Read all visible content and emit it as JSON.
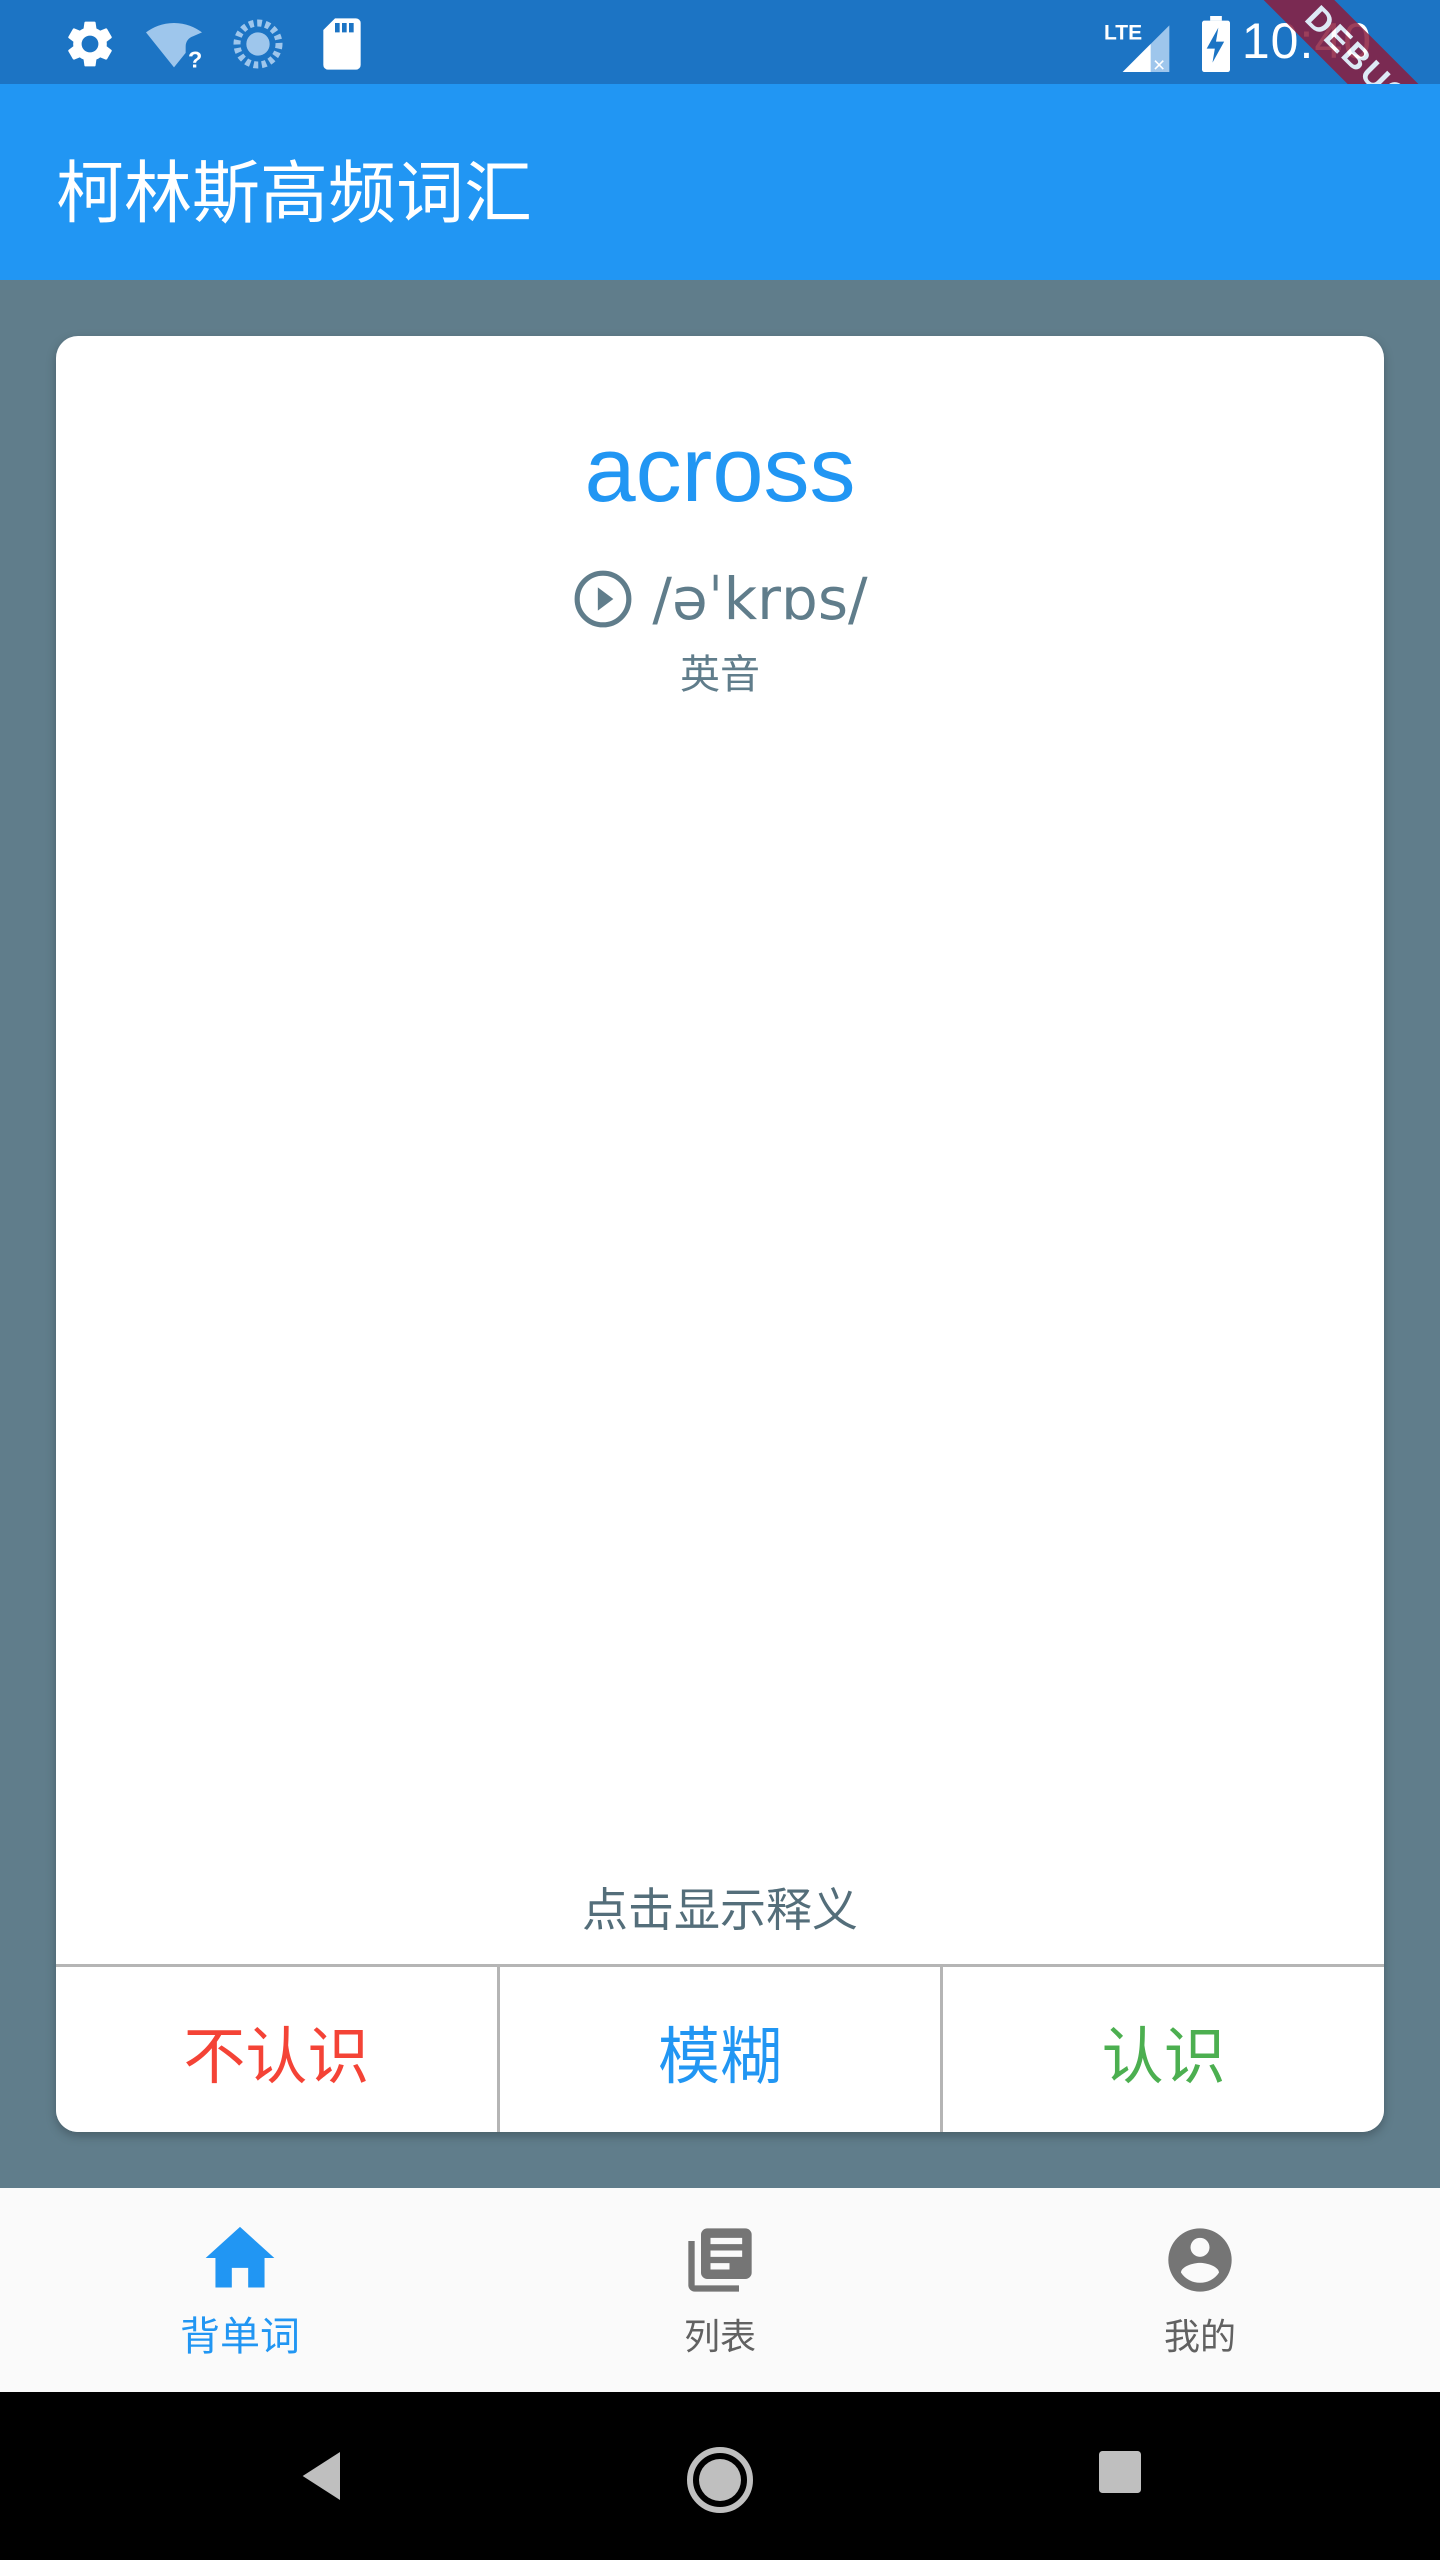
{
  "status_bar": {
    "time": "10:40",
    "debug_label": "DEBUG",
    "network_label": "LTE",
    "icons": [
      "settings-icon",
      "wifi-unknown-icon",
      "sync-icon",
      "sd-card-icon",
      "signal-icon",
      "battery-charging-icon"
    ]
  },
  "app_bar": {
    "title": "柯林斯高频词汇"
  },
  "card": {
    "word": "across",
    "phonetic": "/əˈkrɒs/",
    "accent_label": "英音",
    "play_icon": "play-circle-icon",
    "tap_hint": "点击显示释义",
    "buttons": {
      "unknown": "不认识",
      "vague": "模糊",
      "known": "认识"
    }
  },
  "bottom_nav": {
    "items": [
      {
        "label": "背单词",
        "icon": "home-icon",
        "active": true
      },
      {
        "label": "列表",
        "icon": "list-book-icon",
        "active": false
      },
      {
        "label": "我的",
        "icon": "account-circle-icon",
        "active": false
      }
    ]
  },
  "colors": {
    "primary": "#2196f3",
    "status_bar": "#1c74c4",
    "background": "#607d8b",
    "unknown": "#f44336",
    "known": "#4caf50"
  }
}
